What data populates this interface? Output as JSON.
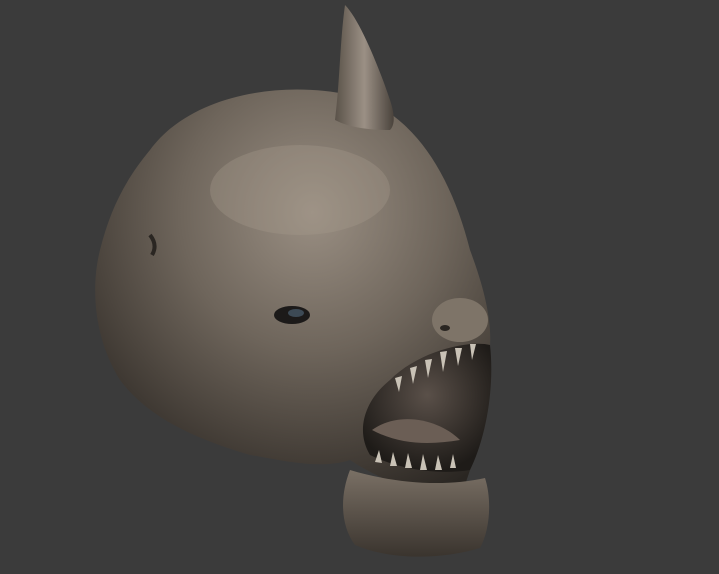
{
  "scene": {
    "subject": "creature-head-sculpt",
    "colors": {
      "background": "#3b3b3b",
      "skin_base": "#5e564d",
      "skin_highlight": "#9a8f83",
      "skin_shadow": "#2a2622",
      "mouth_interior": "#1e1b18",
      "teeth": "#c9c2b6"
    }
  }
}
